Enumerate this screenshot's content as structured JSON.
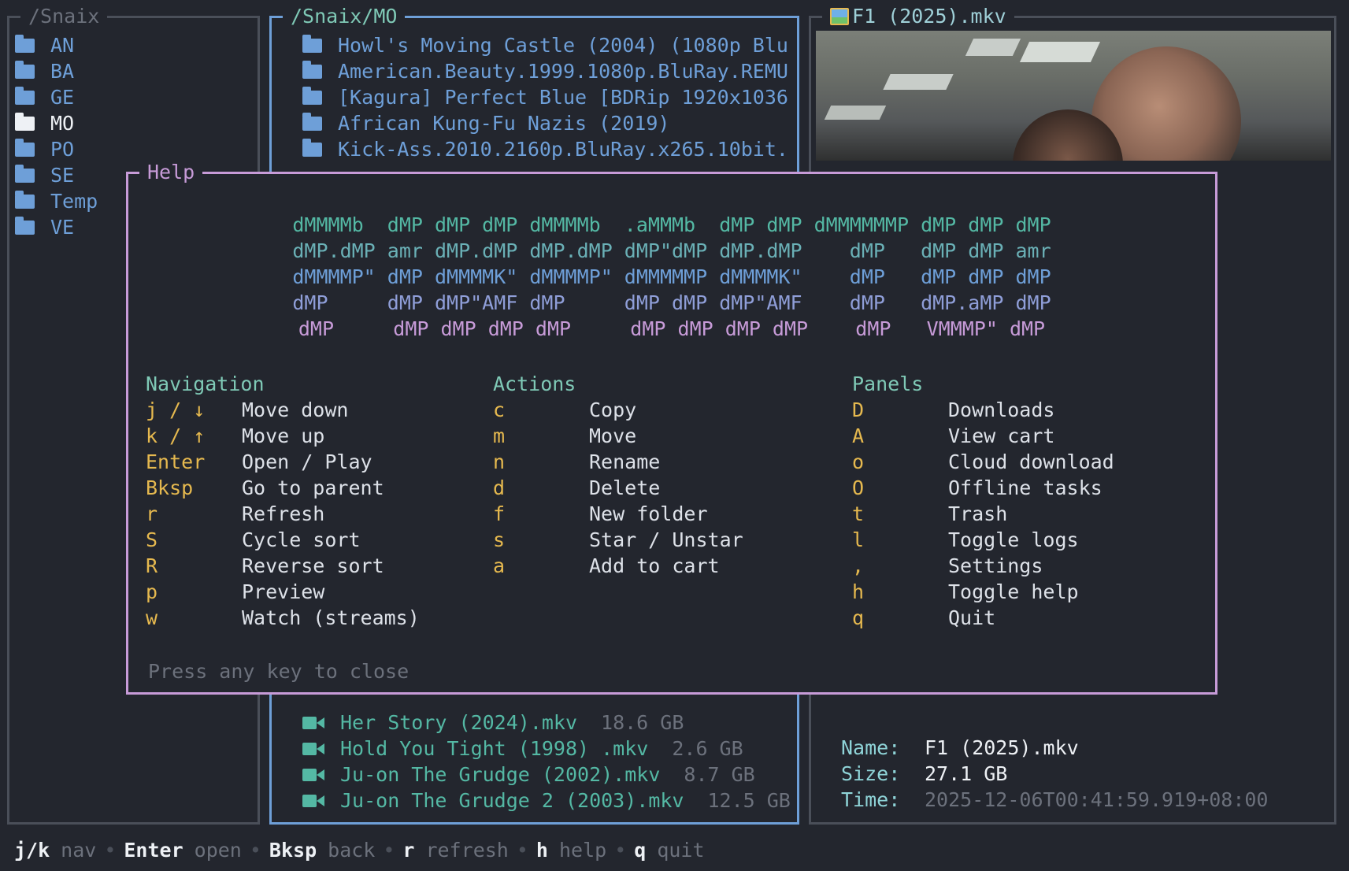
{
  "left_panel": {
    "title": "/Snaix",
    "items": [
      {
        "label": "AN",
        "selected": false
      },
      {
        "label": "BA",
        "selected": false
      },
      {
        "label": "GE",
        "selected": false
      },
      {
        "label": "MO",
        "selected": true
      },
      {
        "label": "PO",
        "selected": false
      },
      {
        "label": "SE",
        "selected": false
      },
      {
        "label": "Temp",
        "selected": false
      },
      {
        "label": "VE",
        "selected": false
      }
    ]
  },
  "middle_panel": {
    "title": "/Snaix/MO",
    "folders": [
      "Howl's Moving Castle (2004) (1080p Blu",
      "American.Beauty.1999.1080p.BluRay.REMU",
      "[Kagura] Perfect Blue [BDRip 1920x1036",
      "African Kung-Fu Nazis (2019)",
      "Kick-Ass.2010.2160p.BluRay.x265.10bit."
    ],
    "files": [
      {
        "name": "Her Story (2024).mkv",
        "size": "18.6 GB"
      },
      {
        "name": "Hold You Tight (1998) .mkv",
        "size": "2.6 GB"
      },
      {
        "name": "Ju-on The Grudge (2002).mkv",
        "size": "8.7 GB"
      },
      {
        "name": "Ju-on The Grudge 2 (2003).mkv",
        "size": "12.5 GB"
      }
    ]
  },
  "right_panel": {
    "title": "F1 (2025).mkv",
    "title_icon": "picture-icon",
    "info": {
      "name_label": "Name:",
      "name": "F1 (2025).mkv",
      "size_label": "Size:",
      "size": "27.1 GB",
      "time_label": "Time:",
      "time": "2025-12-06T00:41:59.919+08:00"
    }
  },
  "help": {
    "title": "Help",
    "ascii_colors": [
      "#54b8a4",
      "#6ab0b6",
      "#6e9fd8",
      "#8f9ed8",
      "#c79bd8"
    ],
    "ascii_lines": [
      "dMMMMb  dMP dMP dMP dMMMMb  .aMMMb  dMP dMP dMMMMMMP dMP dMP dMP",
      "dMP.dMP amr dMP.dMP dMP.dMP dMP\"dMP dMP.dMP    dMP   dMP dMP amr",
      "dMMMMP\" dMP dMMMMK\" dMMMMP\" dMMMMMP dMMMMK\"    dMP   dMP dMP dMP",
      "dMP     dMP dMP\"AMF dMP     dMP dMP dMP\"AMF    dMP   dMP.aMP dMP",
      "dMP     dMP dMP dMP dMP     dMP dMP dMP dMP    dMP   VMMMP\" dMP"
    ],
    "sections": [
      {
        "heading": "Navigation",
        "rows": [
          {
            "key": "j / ↓",
            "desc": "Move down"
          },
          {
            "key": "k / ↑",
            "desc": "Move up"
          },
          {
            "key": "Enter",
            "desc": "Open / Play"
          },
          {
            "key": "Bksp",
            "desc": "Go to parent"
          },
          {
            "key": "r",
            "desc": "Refresh"
          },
          {
            "key": "S",
            "desc": "Cycle sort"
          },
          {
            "key": "R",
            "desc": "Reverse sort"
          },
          {
            "key": "p",
            "desc": "Preview"
          },
          {
            "key": "w",
            "desc": "Watch (streams)"
          }
        ]
      },
      {
        "heading": "Actions",
        "rows": [
          {
            "key": "c",
            "desc": "Copy"
          },
          {
            "key": "m",
            "desc": "Move"
          },
          {
            "key": "n",
            "desc": "Rename"
          },
          {
            "key": "d",
            "desc": "Delete"
          },
          {
            "key": "f",
            "desc": "New folder"
          },
          {
            "key": "s",
            "desc": "Star / Unstar"
          },
          {
            "key": "a",
            "desc": "Add to cart"
          }
        ]
      },
      {
        "heading": "Panels",
        "rows": [
          {
            "key": "D",
            "desc": "Downloads"
          },
          {
            "key": "A",
            "desc": "View cart"
          },
          {
            "key": "o",
            "desc": "Cloud download"
          },
          {
            "key": "O",
            "desc": "Offline tasks"
          },
          {
            "key": "t",
            "desc": "Trash"
          },
          {
            "key": "l",
            "desc": "Toggle logs"
          },
          {
            "key": ",",
            "desc": "Settings"
          },
          {
            "key": "h",
            "desc": "Toggle help"
          },
          {
            "key": "q",
            "desc": "Quit"
          }
        ]
      }
    ],
    "close_hint": "Press any key to close"
  },
  "status_bar": [
    {
      "key": "j/k",
      "desc": "nav"
    },
    {
      "key": "Enter",
      "desc": "open"
    },
    {
      "key": "Bksp",
      "desc": "back"
    },
    {
      "key": "r",
      "desc": "refresh"
    },
    {
      "key": "h",
      "desc": "help"
    },
    {
      "key": "q",
      "desc": "quit"
    }
  ],
  "status_separator": "•"
}
